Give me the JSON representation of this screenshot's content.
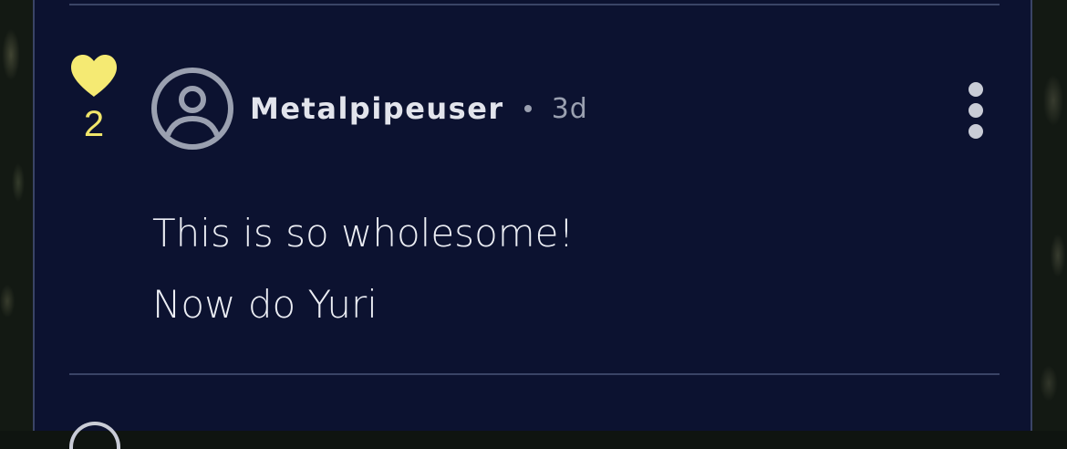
{
  "comment": {
    "votes": "2",
    "username": "Metalpipeuser",
    "time": "3d",
    "lines": [
      "This is so wholesome!",
      "Now do Yuri"
    ]
  },
  "colors": {
    "card_bg": "#0c1230",
    "heart": "#f5ea73",
    "vote_count": "#f0e56a",
    "username": "#e2e4ec",
    "muted": "#9aa0b0",
    "border": "#3a4466"
  },
  "icons": {
    "vote": "heart-icon",
    "avatar": "user-avatar-icon",
    "menu": "more-vertical-icon",
    "next": "partial-icon"
  }
}
